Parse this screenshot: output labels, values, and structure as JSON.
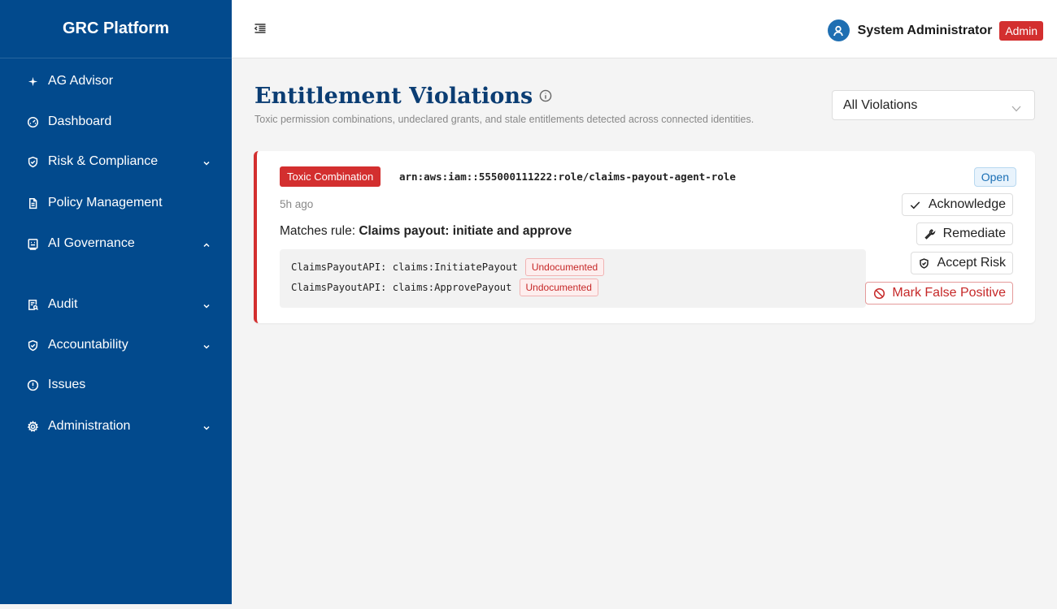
{
  "app": {
    "title": "GRC Platform"
  },
  "sidebar": {
    "items": [
      {
        "label": "AG Advisor",
        "icon": "sparkle-icon"
      },
      {
        "label": "Dashboard",
        "icon": "gauge-icon"
      },
      {
        "label": "Risk & Compliance",
        "icon": "shield-check-icon",
        "expandable": true,
        "expanded": false
      },
      {
        "label": "Policy Management",
        "icon": "document-icon"
      },
      {
        "label": "AI Governance",
        "icon": "ai-board-icon",
        "expandable": true,
        "expanded": true
      },
      {
        "label": "Audit",
        "icon": "audit-icon",
        "expandable": true,
        "expanded": false
      },
      {
        "label": "Accountability",
        "icon": "shield-check-icon",
        "expandable": true,
        "expanded": false
      },
      {
        "label": "Issues",
        "icon": "alert-circle-icon"
      },
      {
        "label": "Administration",
        "icon": "gear-icon",
        "expandable": true,
        "expanded": false
      }
    ]
  },
  "header": {
    "user_name": "System Administrator",
    "role": "Admin",
    "colors": {
      "role_badge": "#d32f2f",
      "avatar": "#1f6fb2"
    }
  },
  "main": {
    "title": "Entitlement Violations",
    "subtitle": "Toxic permission combinations, undeclared grants, and stale entitlements detected across connected identities.",
    "filter": {
      "selected": "All Violations"
    }
  },
  "violation": {
    "type": "Toxic Combination",
    "arn": "arn:aws:iam::555000111222:role/claims-payout-agent-role",
    "status": "Open",
    "time_ago": "5h ago",
    "rule_prefix": "Matches rule:",
    "rule_name": "Claims payout: initiate and approve",
    "permissions": [
      {
        "text": "ClaimsPayoutAPI: claims:InitiatePayout",
        "tag": "Undocumented"
      },
      {
        "text": "ClaimsPayoutAPI: claims:ApprovePayout",
        "tag": "Undocumented"
      }
    ],
    "actions": {
      "acknowledge": "Acknowledge",
      "remediate": "Remediate",
      "accept_risk": "Accept Risk",
      "mark_false_positive": "Mark False Positive"
    }
  },
  "colors": {
    "sidebar": "#024a8d",
    "title": "#0b3d73",
    "danger": "#d32f2f",
    "info": "#1a6fb5"
  }
}
